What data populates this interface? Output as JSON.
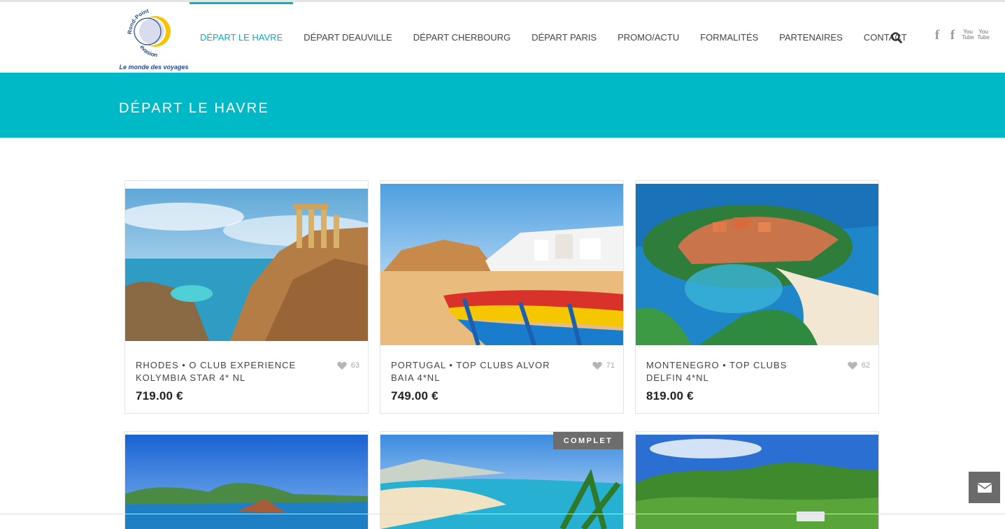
{
  "brand": {
    "logo_text_top": "Rond-Point",
    "logo_text_bottom": "évasion",
    "tagline": "Le monde des voyages"
  },
  "nav": {
    "items": [
      {
        "label": "DÉPART LE HAVRE",
        "active": true
      },
      {
        "label": "DÉPART DEAUVILLE",
        "active": false
      },
      {
        "label": "DÉPART CHERBOURG",
        "active": false
      },
      {
        "label": "DÉPART PARIS",
        "active": false
      },
      {
        "label": "PROMO/ACTU",
        "active": false
      },
      {
        "label": "FORMALITÉS",
        "active": false
      },
      {
        "label": "PARTENAIRES",
        "active": false
      },
      {
        "label": "CONTACT",
        "active": false
      }
    ],
    "search_icon": "search-icon",
    "social": [
      "facebook-icon",
      "facebook-icon",
      "youtube-icon",
      "youtube-icon"
    ],
    "youtube_text": [
      "You",
      "Tube"
    ]
  },
  "page": {
    "title": "DÉPART LE HAVRE"
  },
  "colors": {
    "accent": "#00b9c6",
    "badge": "#6d6d6d"
  },
  "products": [
    {
      "title": "RHODES • O CLUB EXPERIENCE KOLYMBIA STAR 4* NL",
      "likes": "63",
      "price": "719.00 €",
      "image": "rhodes-acropolis-photo"
    },
    {
      "title": "PORTUGAL • TOP CLUBS ALVOR BAIA 4*NL",
      "likes": "71",
      "price": "749.00 €",
      "image": "portugal-beach-boats-photo"
    },
    {
      "title": "MONTENEGRO • TOP CLUBS DELFIN 4*NL",
      "likes": "62",
      "price": "819.00 €",
      "image": "montenegro-island-photo"
    },
    {
      "title": "",
      "likes": "",
      "price": "",
      "image": "coastal-bay-photo"
    },
    {
      "title": "",
      "likes": "",
      "price": "",
      "image": "beach-lagoon-photo",
      "badge": "COMPLET"
    },
    {
      "title": "",
      "likes": "",
      "price": "",
      "image": "forest-hills-photo"
    }
  ],
  "contact_widget": {
    "icon": "envelope-icon"
  }
}
